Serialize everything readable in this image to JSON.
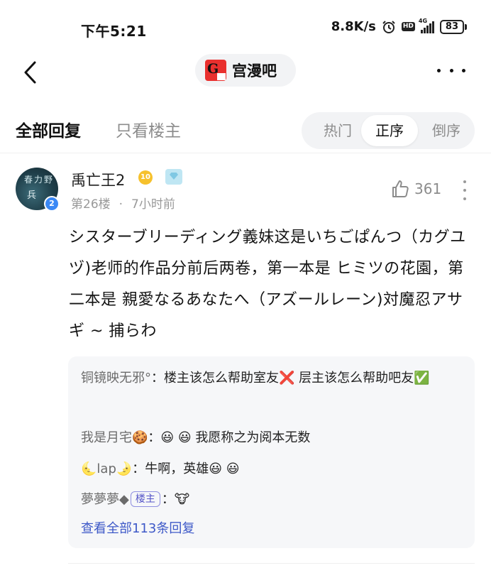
{
  "status_bar": {
    "time": "下午5:21",
    "net_speed": "8.8K/s",
    "hd": "HD",
    "network": "4G",
    "battery": "83"
  },
  "nav": {
    "forum_name": "宫漫吧"
  },
  "tabs": {
    "all_replies": "全部回复",
    "only_op": "只看楼主",
    "sort": [
      "热门",
      "正序",
      "倒序"
    ],
    "sort_selected": "正序"
  },
  "post": {
    "username": "禹亡王2",
    "level": "10",
    "avatar_badge": "2",
    "floor": "第26楼",
    "separator": "·",
    "time": "7小时前",
    "likes": "361",
    "content": "シスターブリーディング義妹这是いちごぱんつ（カグユヅ)老师的作品分前后两卷，第一本是 ヒミツの花園，第二本是 親愛なるあなたへ（アズールレーン)対魔忍アサギ ~ 捕らわ"
  },
  "sub_replies": [
    {
      "user": "铜镜映无邪°",
      "text": "楼主该怎么帮助室友❌ 层主该怎么帮助吧友✅"
    },
    {
      "user": "我是月宅🍪",
      "text": "😃 😃 我愿称之为阅本无数"
    },
    {
      "user": "🌜lap🌛",
      "text": "牛啊，英雄😃 😃"
    },
    {
      "user": "夢夢夢◆",
      "tag": "楼主",
      "text": "🐮"
    }
  ],
  "view_all": "查看全部113条回复",
  "colors": {
    "link": "#3e59c8",
    "muted": "#999999",
    "panel": "#f6f7f9",
    "level_badge": "#f6c12c"
  }
}
